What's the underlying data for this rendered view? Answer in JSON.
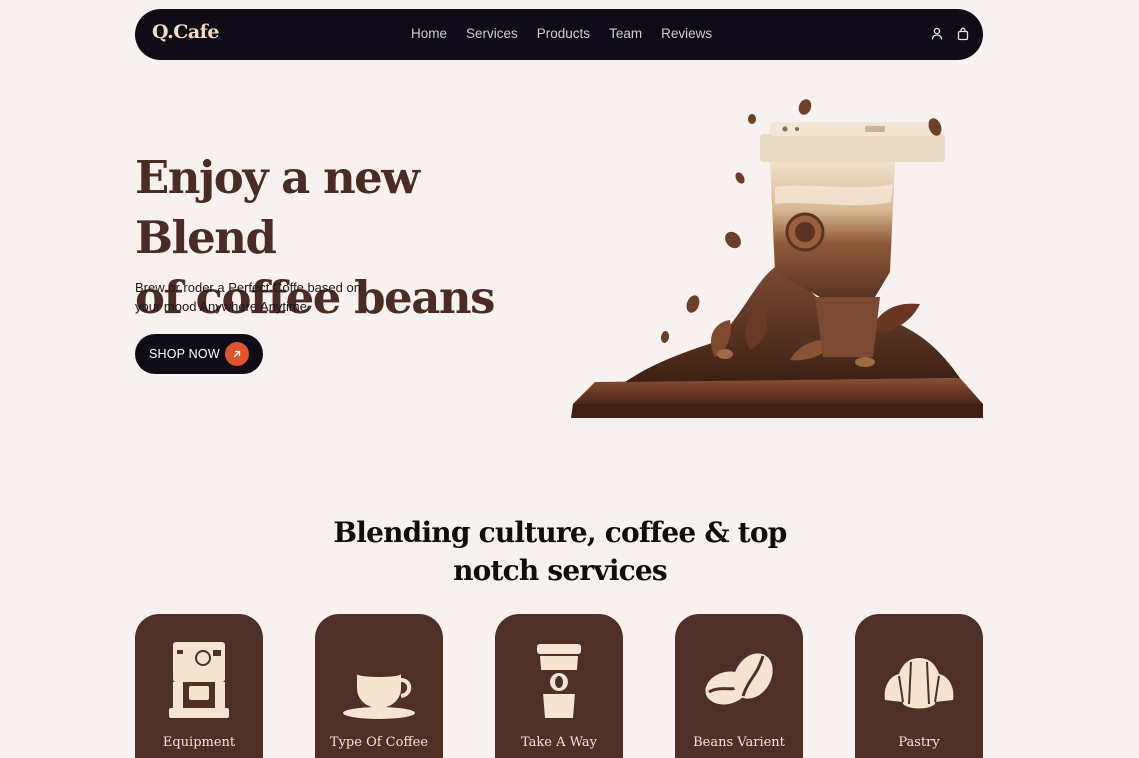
{
  "brand": {
    "logo": "Q.Cafe"
  },
  "nav": {
    "links": [
      {
        "label": "Home"
      },
      {
        "label": "Services"
      },
      {
        "label": "Products"
      },
      {
        "label": "Team"
      },
      {
        "label": "Reviews"
      }
    ],
    "icons": [
      "user-icon",
      "shopping-bag-icon"
    ]
  },
  "hero": {
    "title_line1": "Enjoy a new Blend",
    "title_line2": "of coffee beans",
    "subtitle_line1": "Brew or roder a Perfect Coffe based on",
    "subtitle_line2": "your mood Anywhere Anytime",
    "cta_label": "SHOP NOW",
    "cta_icon": "arrow-up-right-icon"
  },
  "services": {
    "title_line1": "Blending culture, coffee & top",
    "title_line2": "notch services",
    "cards": [
      {
        "label": "Equipment",
        "icon": "espresso-machine-icon"
      },
      {
        "label": "Type Of Coffee",
        "icon": "coffee-cup-icon"
      },
      {
        "label": "Take A Way",
        "icon": "takeaway-cup-icon"
      },
      {
        "label": "Beans Varient",
        "icon": "coffee-beans-icon"
      },
      {
        "label": "Pastry",
        "icon": "croissant-icon"
      }
    ]
  },
  "colors": {
    "background": "#f7f2ef",
    "nav_bg": "#0f0c18",
    "heading_brown": "#4a2c24",
    "card_bg": "#4f3026",
    "accent": "#e0542c",
    "cream": "#f4e4d0"
  }
}
